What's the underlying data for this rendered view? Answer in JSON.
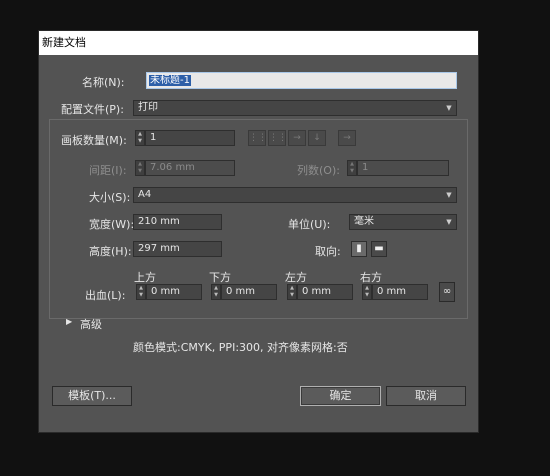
{
  "window": {
    "title": "新建文档"
  },
  "name": {
    "label": "名称(N):",
    "value": "未标题-1"
  },
  "profile": {
    "label": "配置文件(P):",
    "value": "打印"
  },
  "artboards": {
    "count_label": "画板数量(M):",
    "count_value": "1",
    "spacing_label": "间距(I):",
    "spacing_value": "7.06 mm",
    "columns_label": "列数(O):",
    "columns_value": "1"
  },
  "size": {
    "label": "大小(S):",
    "value": "A4"
  },
  "width": {
    "label": "宽度(W):",
    "value": "210 mm"
  },
  "height": {
    "label": "高度(H):",
    "value": "297 mm"
  },
  "units": {
    "label": "单位(U):",
    "value": "毫米"
  },
  "orientation": {
    "label": "取向:"
  },
  "bleed": {
    "label": "出血(L):",
    "top_label": "上方",
    "top_value": "0 mm",
    "bottom_label": "下方",
    "bottom_value": "0 mm",
    "left_label": "左方",
    "left_value": "0 mm",
    "right_label": "右方",
    "right_value": "0 mm"
  },
  "advanced": {
    "label": "高级"
  },
  "info": {
    "text": "颜色模式:CMYK, PPI:300, 对齐像素网格:否"
  },
  "buttons": {
    "templates": "模板(T)...",
    "ok": "确定",
    "cancel": "取消"
  }
}
